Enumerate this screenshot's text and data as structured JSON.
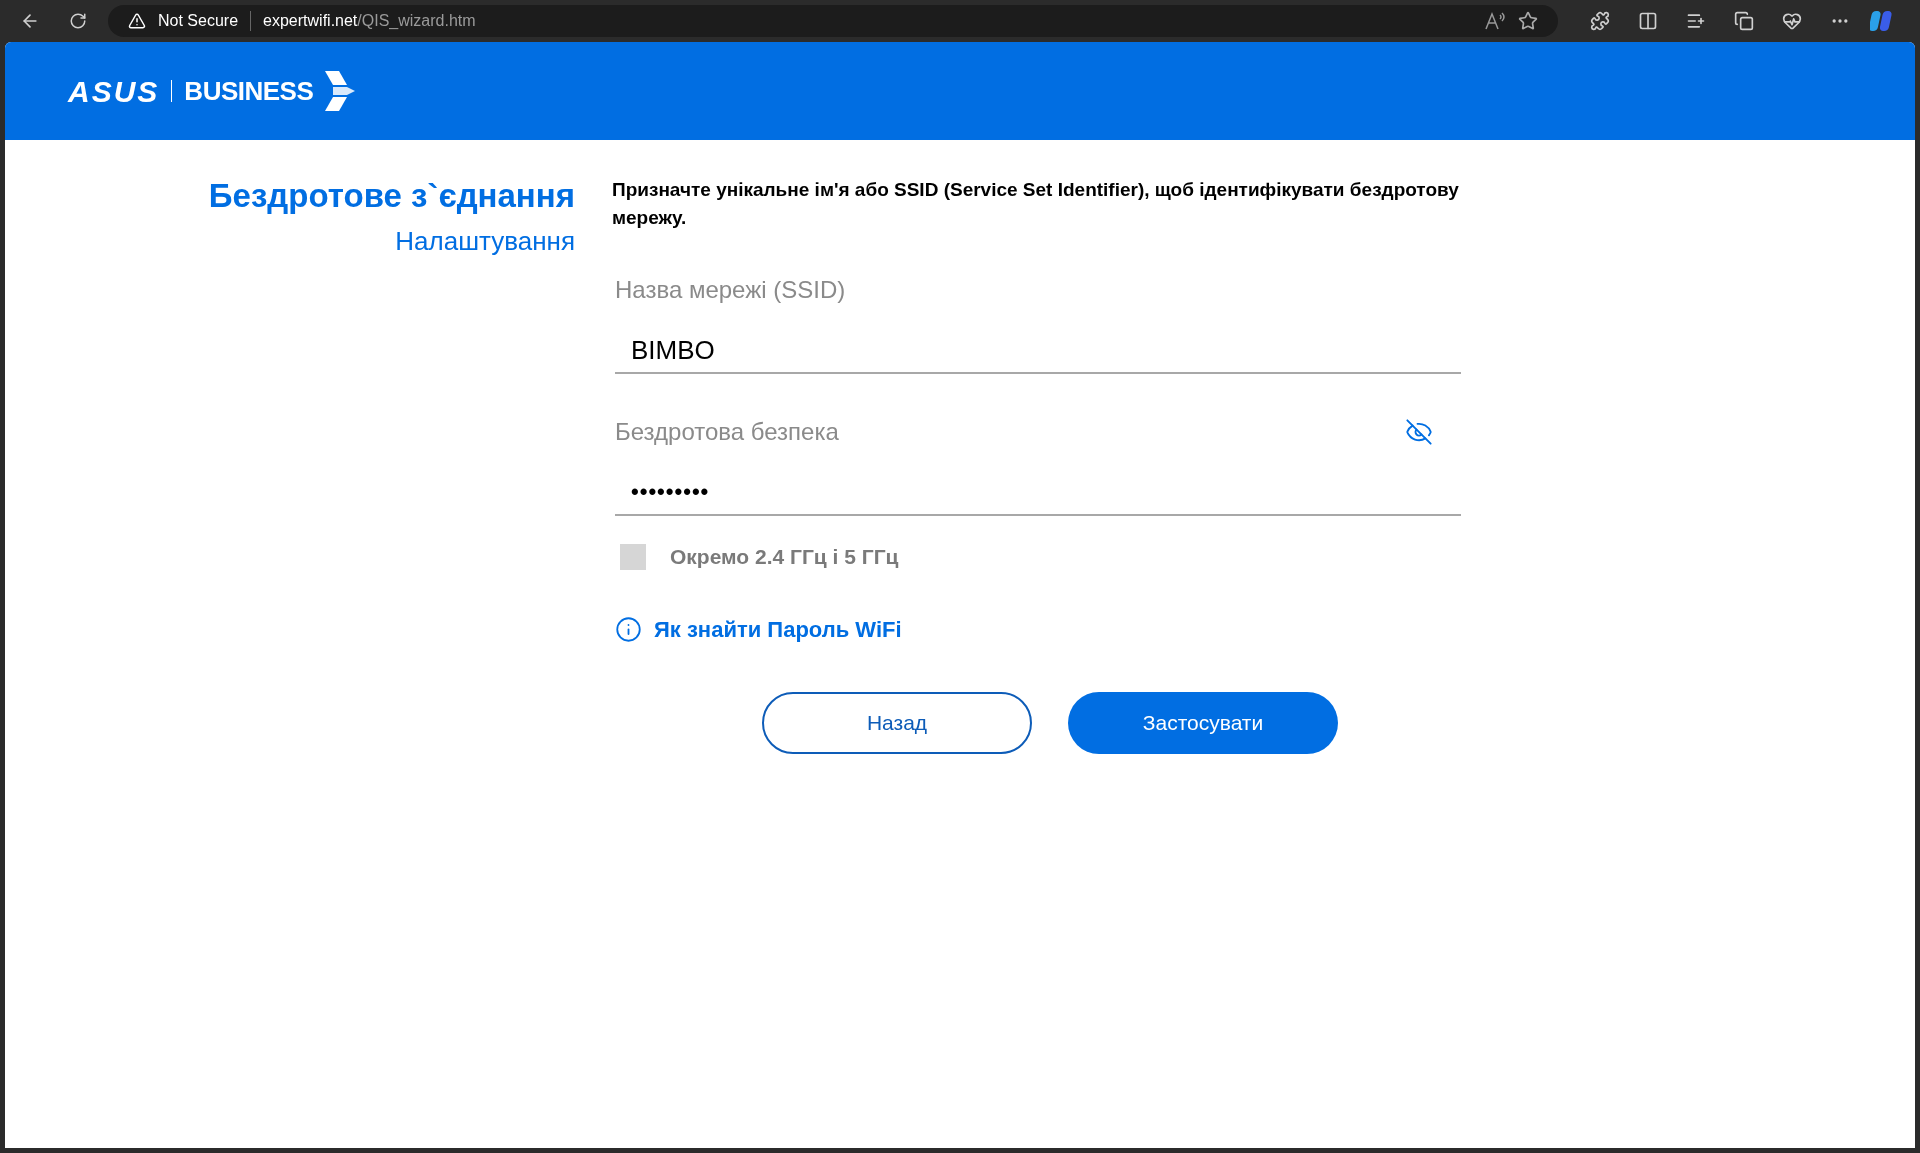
{
  "browser": {
    "security_label": "Not Secure",
    "url_domain": "expertwifi.net",
    "url_path": "/QIS_wizard.htm"
  },
  "header": {
    "brand": "ASUS",
    "division": "BUSINESS"
  },
  "sidebar": {
    "title": "Бездротове з`єднання",
    "subtitle": "Налаштування"
  },
  "description": "Призначте унікальне ім'я або SSID (Service Set Identifier), щоб ідентифікувати бездротову мережу.",
  "fields": [
    {
      "kind": "text",
      "label": "Назва мережі (SSID)",
      "value": "BIMBO"
    },
    {
      "kind": "password",
      "label": "Бездротова безпека",
      "value": "•••••••••"
    }
  ],
  "separate_bands": {
    "label": "Окремо 2.4 ГГц і 5 ГГц",
    "checked": false
  },
  "help_link": "Як знайти Пароль WiFi",
  "buttons": [
    {
      "kind": "secondary",
      "label": "Назад"
    },
    {
      "kind": "primary",
      "label": "Застосувати"
    }
  ]
}
